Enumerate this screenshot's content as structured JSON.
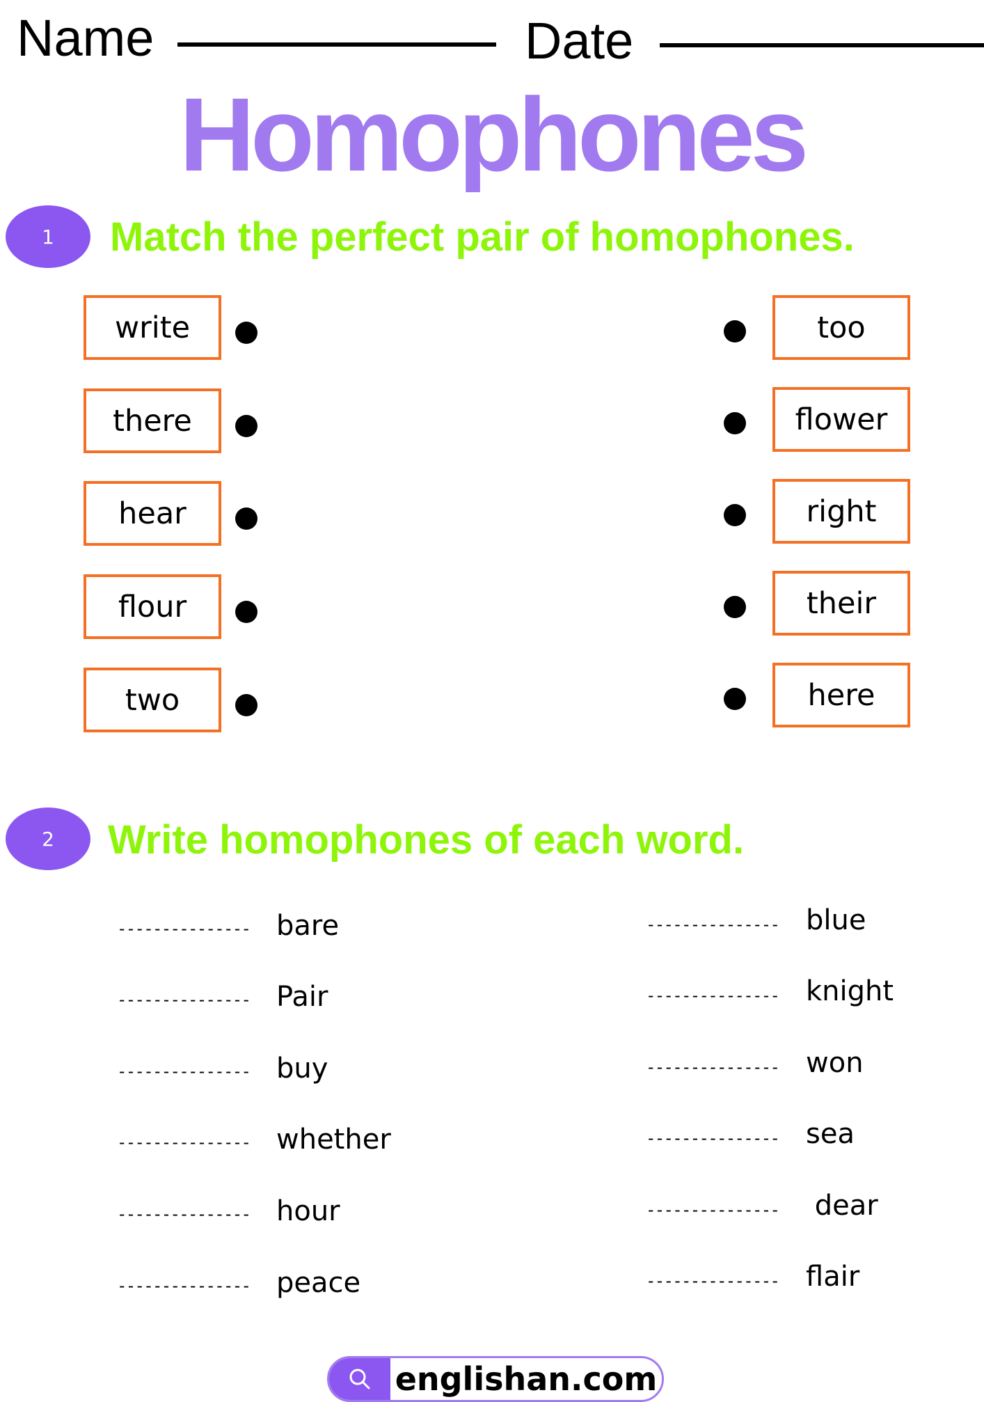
{
  "colors": {
    "title": "#a27af0",
    "heading": "#8ef50a",
    "circle": "#8b57f0",
    "box_border": "#f37024",
    "text": "#000000"
  },
  "header": {
    "name_label": "Name",
    "date_label": "Date"
  },
  "title": "Homophones",
  "section1": {
    "number": "1",
    "heading": "Match  the perfect pair of homophones.",
    "left_words": [
      "write",
      "there",
      "hear",
      "flour",
      "two"
    ],
    "right_words": [
      "too",
      "flower",
      "right",
      "their",
      "here"
    ]
  },
  "section2": {
    "number": "2",
    "heading": "Write homophones of each word.",
    "blank": "---------------",
    "left_words": [
      "bare",
      "Pair",
      "buy",
      "whether",
      "hour",
      "peace"
    ],
    "right_words": [
      "blue",
      "knight",
      "won",
      "sea",
      " dear",
      "flair"
    ]
  },
  "footer": {
    "icon": "search-icon",
    "site": "englishan.com"
  }
}
